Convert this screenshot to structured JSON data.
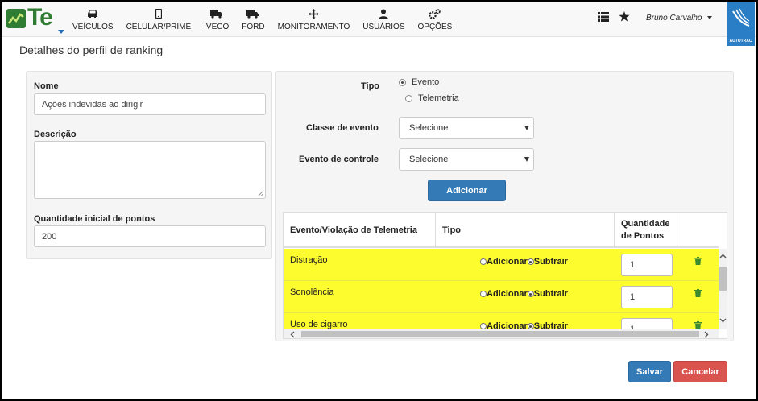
{
  "nav": {
    "items": [
      {
        "label": "VEÍCULOS",
        "icon": "car-icon"
      },
      {
        "label": "CELULAR/PRIME",
        "icon": "phone-icon"
      },
      {
        "label": "IVECO",
        "icon": "truck-icon"
      },
      {
        "label": "FORD",
        "icon": "truck-icon"
      },
      {
        "label": "MONITORAMENTO",
        "icon": "crosshair-icon"
      },
      {
        "label": "USUÁRIOS",
        "icon": "user-icon"
      },
      {
        "label": "OPÇÕES",
        "icon": "cogs-icon"
      }
    ],
    "logo_text": "Te",
    "user_name": "Bruno Carvalho",
    "brand_text": "AUTOTRAC"
  },
  "page": {
    "title": "Detalhes do perfil de ranking"
  },
  "form": {
    "nome_label": "Nome",
    "nome_value": "Ações indevidas ao dirigir",
    "descricao_label": "Descrição",
    "descricao_value": "",
    "pontos_label": "Quantidade inicial de pontos",
    "pontos_value": "200"
  },
  "config": {
    "tipo_label": "Tipo",
    "tipo_options": [
      "Evento",
      "Telemetria"
    ],
    "tipo_selected": "Evento",
    "classe_label": "Classe de evento",
    "classe_value": "Selecione",
    "controle_label": "Evento de controle",
    "controle_value": "Selecione",
    "add_button": "Adicionar"
  },
  "table": {
    "headers": [
      "Evento/Violação de Telemetria",
      "Tipo",
      "Quantidade de Pontos",
      ""
    ],
    "add_label": "Adicionar",
    "subtract_label": "Subtrair",
    "rows": [
      {
        "name": "Distração",
        "selected": "Subtrair",
        "qty": "1"
      },
      {
        "name": "Sonolência",
        "selected": "Subtrair",
        "qty": "1"
      },
      {
        "name": "Uso de cigarro",
        "selected": "Subtrair",
        "qty": "1"
      }
    ],
    "highlight_color": "#fcfc2e"
  },
  "actions": {
    "save": "Salvar",
    "cancel": "Cancelar"
  }
}
